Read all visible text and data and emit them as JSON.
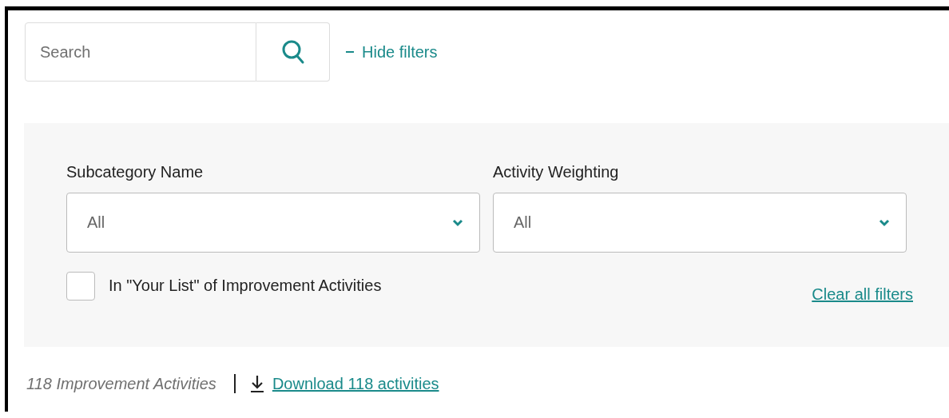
{
  "search": {
    "placeholder": "Search"
  },
  "filter_toggle": {
    "label": "Hide filters",
    "expanded": true
  },
  "filters": [
    {
      "label": "Subcategory Name",
      "value": "All"
    },
    {
      "label": "Activity Weighting",
      "value": "All"
    }
  ],
  "checkbox": {
    "label": "In \"Your List\" of Improvement Activities",
    "checked": false
  },
  "clear_link": "Clear all filters",
  "results": {
    "count": "118 Improvement Activities",
    "download": "Download 118 activities"
  }
}
